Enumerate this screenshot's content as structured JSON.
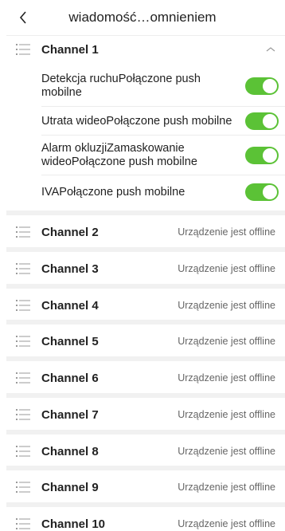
{
  "header": {
    "title": "wiadomość…omnieniem"
  },
  "colors": {
    "accent": "#5bc236"
  },
  "channel1": {
    "label": "Channel 1",
    "expanded": true,
    "items": [
      {
        "label": "Detekcja ruchuPołączone push mobilne",
        "enabled": true
      },
      {
        "label": "Utrata wideoPołączone push mobilne",
        "enabled": true
      },
      {
        "label": "Alarm okluzjiZamaskowanie wideoPołączone push mobilne",
        "enabled": true
      },
      {
        "label": "IVAPołączone push mobilne",
        "enabled": true
      }
    ]
  },
  "channels": [
    {
      "label": "Channel 2",
      "status": "Urządzenie jest offline"
    },
    {
      "label": "Channel 3",
      "status": "Urządzenie jest offline"
    },
    {
      "label": "Channel 4",
      "status": "Urządzenie jest offline"
    },
    {
      "label": "Channel 5",
      "status": "Urządzenie jest offline"
    },
    {
      "label": "Channel 6",
      "status": "Urządzenie jest offline"
    },
    {
      "label": "Channel 7",
      "status": "Urządzenie jest offline"
    },
    {
      "label": "Channel 8",
      "status": "Urządzenie jest offline"
    },
    {
      "label": "Channel 9",
      "status": "Urządzenie jest offline"
    },
    {
      "label": "Channel 10",
      "status": "Urządzenie jest offline"
    }
  ]
}
